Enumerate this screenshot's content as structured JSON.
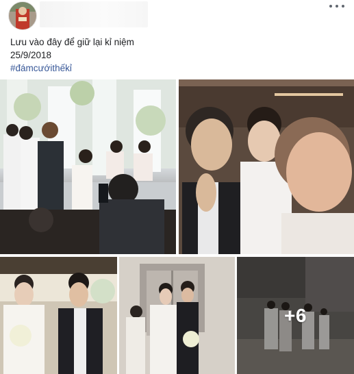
{
  "post": {
    "author_avatar": "profile-photo",
    "more_menu_icon": "ellipsis-icon",
    "text_line1": "Lưu vào đây để giữ lại kỉ niệm",
    "text_line2": "25/9/2018",
    "hashtag": "#đámcướithếkỉ"
  },
  "photos": {
    "items": [
      {
        "desc": "stage with bride, groom, singer and bridesmaids"
      },
      {
        "desc": "group selfie with couple"
      },
      {
        "desc": "bride and groom with bouquet"
      },
      {
        "desc": "bride with guest by elevator"
      },
      {
        "desc": "group photo in hall"
      }
    ],
    "more_count": "+6"
  },
  "colors": {
    "text": "#1c1e21",
    "hashtag": "#385898",
    "menu_dots": "#606770"
  }
}
